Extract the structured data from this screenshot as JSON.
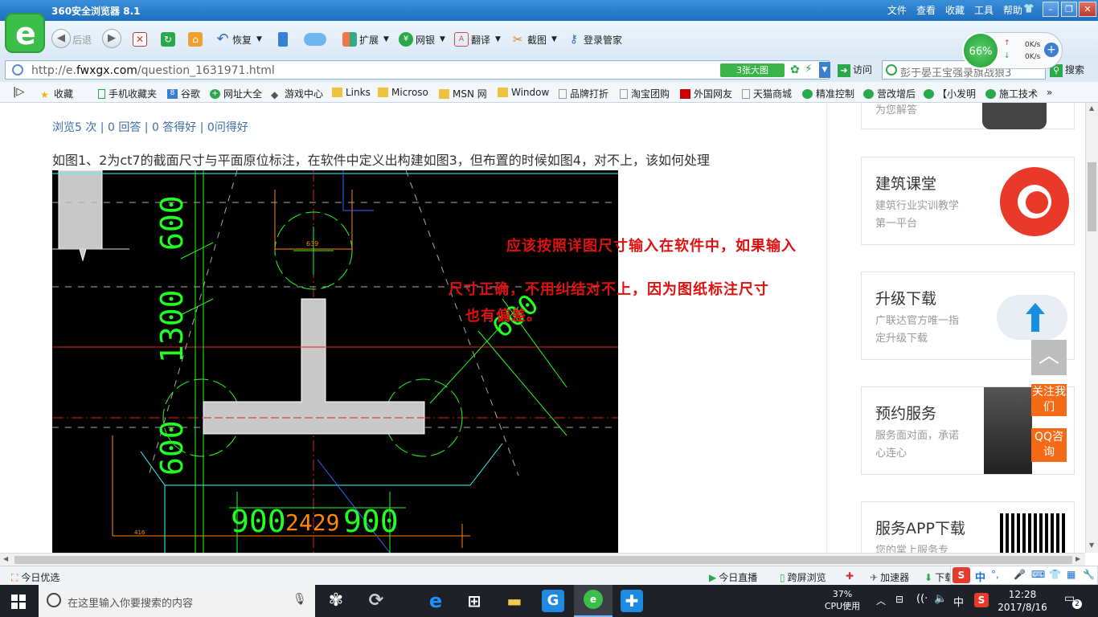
{
  "window": {
    "title": "360安全浏览器 8.1"
  },
  "top_menu": [
    "文件",
    "查看",
    "收藏",
    "工具",
    "帮助"
  ],
  "toolbar": {
    "back": "后退",
    "restore": "恢复",
    "extend": "扩展",
    "netbank": "网银",
    "translate": "翻译",
    "screenshot": "截图",
    "login_manager": "登录管家"
  },
  "speed_widget": {
    "percent": "66%",
    "up": "0K/s",
    "down": "0K/s"
  },
  "address": {
    "url_prefix": "http://e.",
    "url_domain": "fwxgx.com",
    "url_path": "/question_1631971.html",
    "big_image_btn": "3张大图",
    "visit": "访问",
    "search_text": "彭于晏王宝强录旗战狼3",
    "search_btn": "搜索"
  },
  "bookmarks": [
    "收藏",
    "手机收藏夹",
    "谷歌",
    "网址大全",
    "游戏中心",
    "Links",
    "Microso",
    "MSN 网",
    "Window",
    "品牌打折",
    "淘宝团购",
    "外国网友",
    "天猫商城",
    "精准控制",
    "营改增后",
    "【小发明",
    "施工技术"
  ],
  "question": {
    "stats": "浏览5 次 | 0 回答 | 0 答得好 | 0问得好",
    "text": "如图1、2为ct7的截面尺寸与平面原位标注，在软件中定义出构建如图3，但布置的时候如图4，对不上，该如何处理"
  },
  "answer_lines": [
    "应该按照详图尺寸输入在软件中，如果输入",
    "尺寸正确，不用纠结对不上，因为图纸标注尺寸",
    "也有偏差。"
  ],
  "cad": {
    "labels": {
      "dim_600_top": "600",
      "dim_1300": "1300",
      "dim_600_bottom": "600",
      "dim_600_diag": "600",
      "dim_900_left": "900",
      "dim_2429": "2429",
      "dim_900_right": "900",
      "small_top": "639",
      "small_bottom": "416"
    }
  },
  "sidebar": {
    "partial_card_text": "为您解答",
    "cards": [
      {
        "title": "建筑课堂",
        "sub": "建筑行业实训教学第一平台"
      },
      {
        "title": "升级下载",
        "sub": "广联达官方唯一指定升级下载"
      },
      {
        "title": "预约服务",
        "sub": "服务面对面，承诺心连心"
      },
      {
        "title": "服务APP下载",
        "sub": "您的掌上服务专"
      }
    ],
    "float_top": "︿",
    "follow": "关注我们",
    "qq": "QQ咨询"
  },
  "statusbar": {
    "left": "今日优选",
    "live": "今日直播",
    "cross_screen": "跨屏浏览",
    "accelerator": "加速器",
    "download": "下载"
  },
  "ime": {
    "lang": "中"
  },
  "taskbar": {
    "search_placeholder": "在这里输入你要搜索的内容",
    "cpu_percent": "37%",
    "cpu_label": "CPU使用",
    "lang": "中",
    "time": "12:28",
    "date": "2017/8/16",
    "notifications": "2"
  },
  "colors": {
    "titlebar": "#1f6fc0",
    "cad_bg": "#000000",
    "answer_red": "#e01010",
    "accent_orange": "#f56a14",
    "link_blue": "#3a6ea5"
  }
}
